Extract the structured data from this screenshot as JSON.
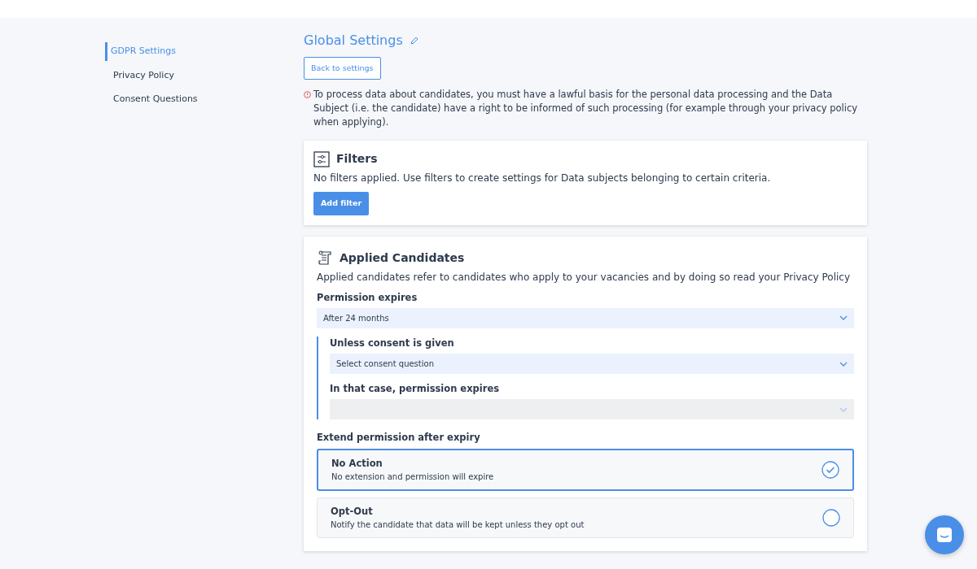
{
  "sidebar": {
    "items": [
      {
        "label": "GDPR Settings",
        "selected": true
      },
      {
        "label": "Privacy Policy",
        "selected": false
      },
      {
        "label": "Consent Questions",
        "selected": false
      }
    ]
  },
  "header": {
    "title": "Global Settings",
    "back_button": "Back to settings"
  },
  "notice": "To process data about candidates, you must have a lawful basis for the personal data processing and the Data Subject (i.e. the candidate) have a right to be informed of such processing (for example through your privacy policy when applying).",
  "filters": {
    "title": "Filters",
    "description": "No filters applied. Use filters to create settings for Data subjects belonging to certain criteria.",
    "button": "Add filter"
  },
  "applied_candidates": {
    "title": "Applied Candidates",
    "description": "Applied candidates refer to candidates who apply to your vacancies and by doing so read your Privacy Policy",
    "permission": {
      "label": "Permission expires",
      "value": "After 24 months",
      "disabled": false
    },
    "conditions": [
      {
        "label": "Unless consent is given",
        "value": "Select consent question",
        "disabled": false
      },
      {
        "label": "In that case, permission expires",
        "disabled": true
      }
    ],
    "extend_label": "Extend permission after expiry",
    "options": [
      {
        "title": "No Action",
        "description": "No extension and permission will expire",
        "selected": true
      },
      {
        "title": "Opt-Out",
        "description": "Notify the candidate that data will be kept unless they opt out",
        "selected": false
      }
    ]
  }
}
